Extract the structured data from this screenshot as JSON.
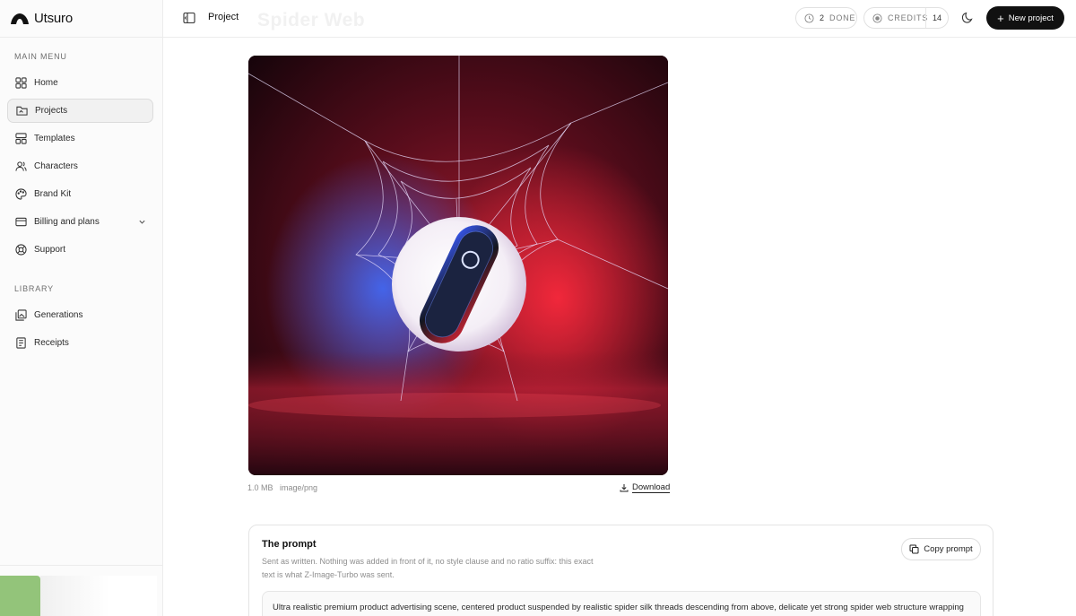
{
  "app": {
    "name": "Utsuro"
  },
  "sidebar": {
    "main_label": "MAIN MENU",
    "main_items": [
      {
        "label": "Home",
        "icon": "grid-icon"
      },
      {
        "label": "Projects",
        "icon": "folder-icon",
        "active": true
      },
      {
        "label": "Templates",
        "icon": "templates-icon"
      },
      {
        "label": "Characters",
        "icon": "users-icon"
      },
      {
        "label": "Brand Kit",
        "icon": "palette-icon"
      },
      {
        "label": "Billing and plans",
        "icon": "card-icon",
        "expandable": true
      },
      {
        "label": "Support",
        "icon": "lifebuoy-icon"
      }
    ],
    "library_label": "LIBRARY",
    "library_items": [
      {
        "label": "Generations",
        "icon": "gallery-icon"
      },
      {
        "label": "Receipts",
        "icon": "receipt-icon"
      }
    ]
  },
  "topbar": {
    "title": "Project",
    "faded_heading": "Spider Web",
    "done": {
      "count": "2",
      "label": "DONE"
    },
    "credits": {
      "label": "CREDITS",
      "value": "14"
    },
    "new_button": "New project"
  },
  "image": {
    "size": "1.0 MB",
    "type": "image/png",
    "download_label": "Download"
  },
  "prompt": {
    "title": "The prompt",
    "description": "Sent as written. Nothing was added in front of it, no style clause and no ratio suffix: this exact text is what Z-Image-Turbo was sent.",
    "copy_label": "Copy prompt",
    "text": "Ultra realistic premium product advertising scene, centered product suspended by realistic spider silk threads descending from above, delicate yet strong spider web structure wrapping"
  },
  "colors": {
    "accent": "#111111",
    "sidebar_bg": "#fbfbfb",
    "border": "#ececec"
  }
}
